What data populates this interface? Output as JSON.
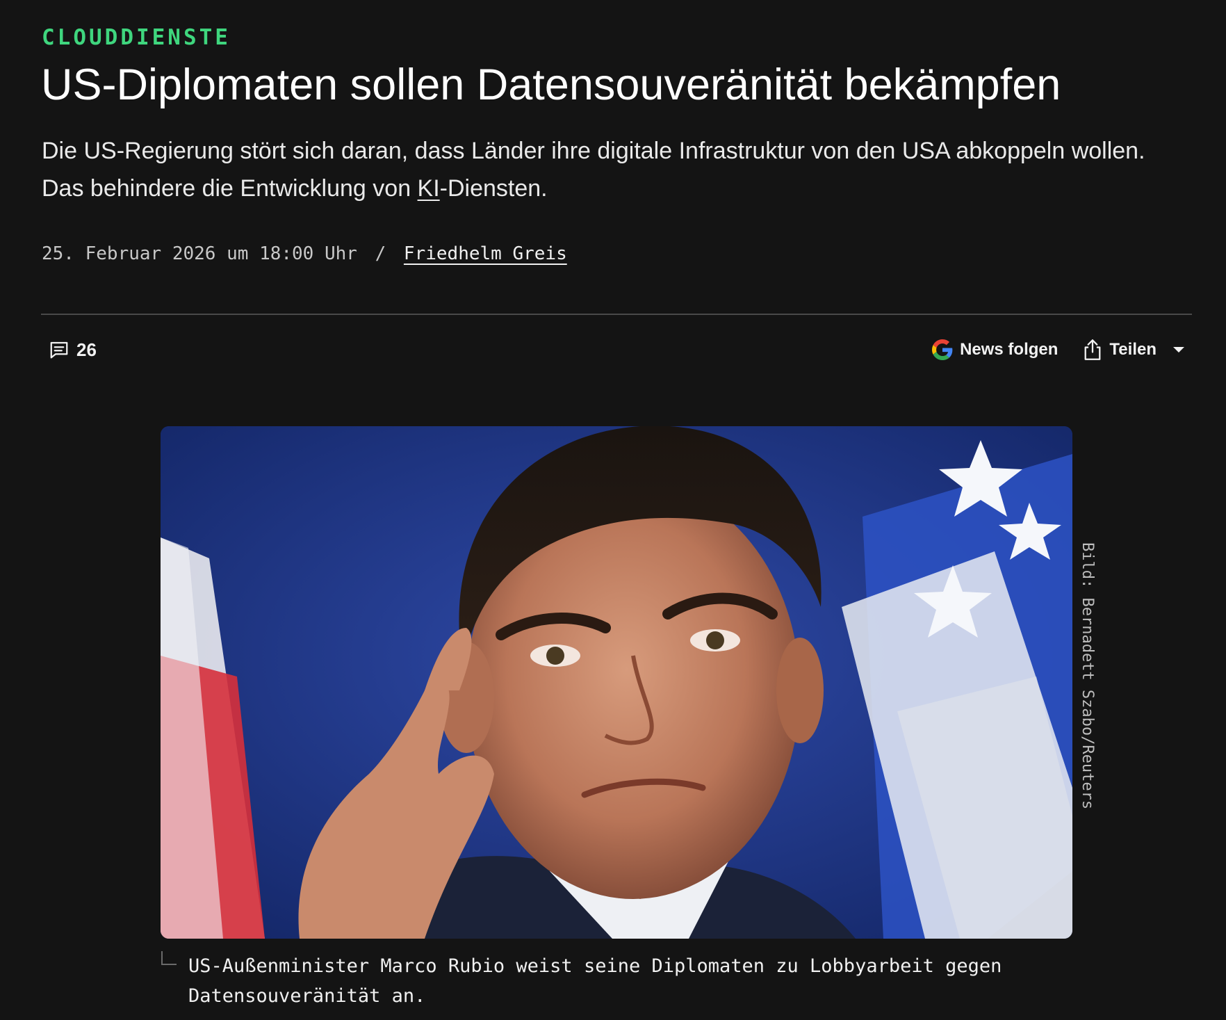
{
  "article": {
    "kicker": "CLOUDDIENSTE",
    "headline": "US-Diplomaten sollen Datensouveränität bekämpfen",
    "teaser_part1": "Die US-Regierung stört sich daran, dass Länder ihre digitale Infrastruktur von den USA abkoppeln wollen. Das behindere die Entwicklung von ",
    "teaser_abbr": "KI",
    "teaser_part2": "-Diensten.",
    "date": "25. Februar 2026 um 18:00 Uhr",
    "separator": "/",
    "author": "Friedhelm Greis"
  },
  "toolbar": {
    "comment_count": "26",
    "news_label": "News folgen",
    "share_label": "Teilen"
  },
  "image": {
    "credit": "Bild: Bernadett Szabo/Reuters",
    "caption": "US-Außenminister Marco Rubio weist seine Diplomaten zu Lobbyarbeit gegen Datensouveränität an."
  },
  "colors": {
    "background": "#141414",
    "kicker": "#3fd67e",
    "text": "#f2f2f2"
  },
  "icons": [
    "comment-icon",
    "google-g-icon",
    "share-icon",
    "caret-down-icon"
  ]
}
